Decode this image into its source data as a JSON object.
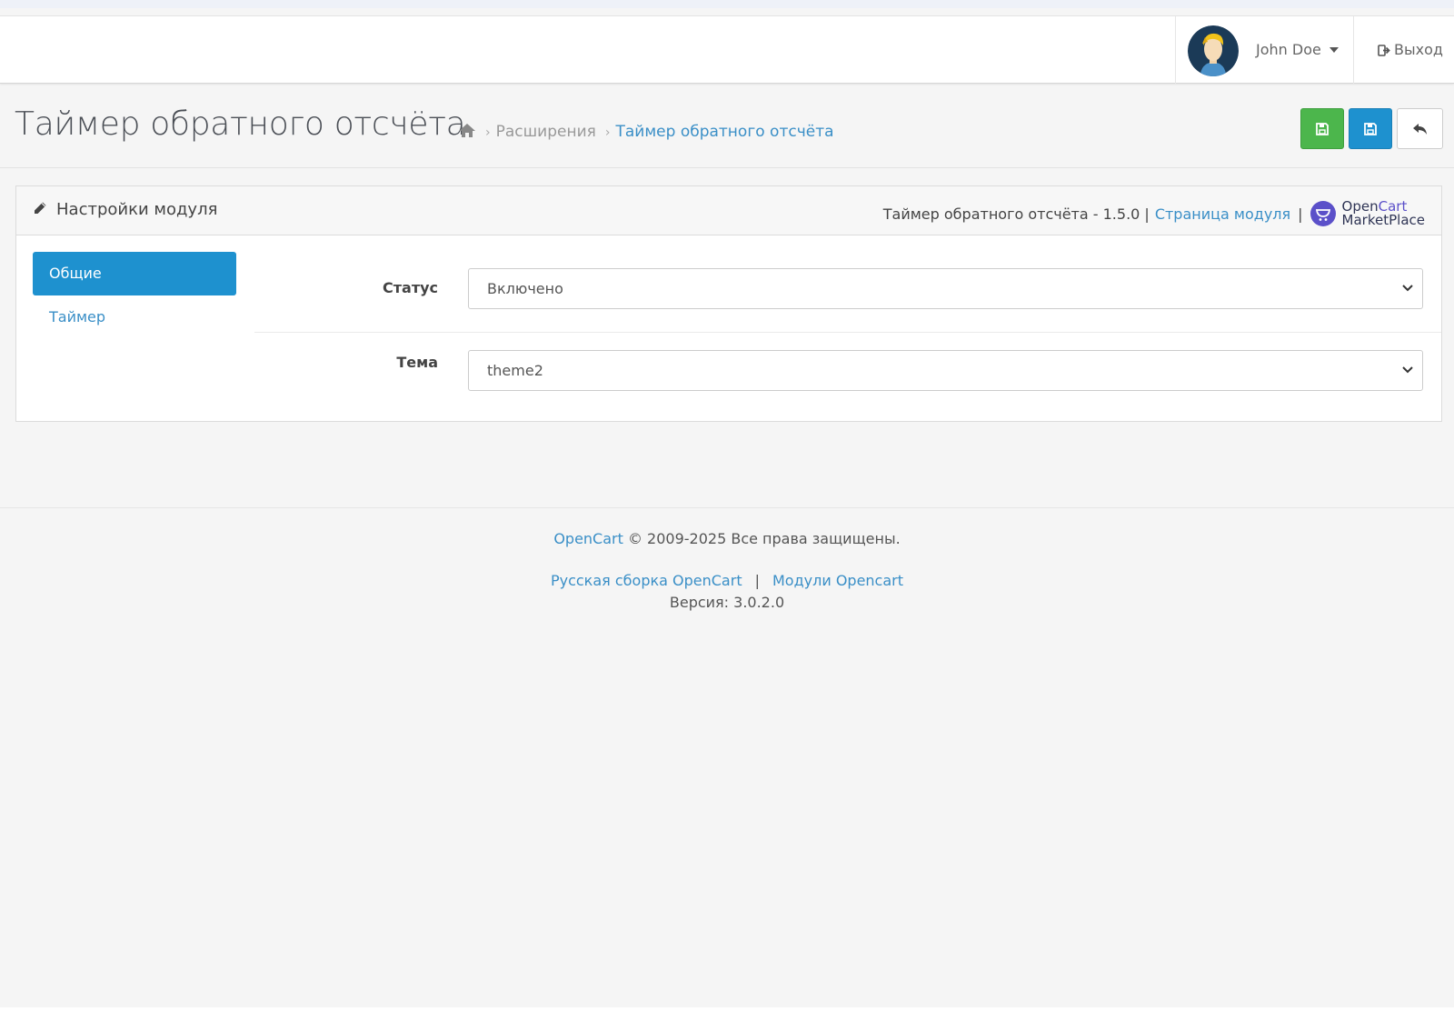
{
  "header": {
    "user_name": "John Doe",
    "logout_label": "Выход"
  },
  "page": {
    "title": "Таймер обратного отсчёта",
    "breadcrumb": [
      "Расширения",
      "Таймер обратного отсчёта"
    ]
  },
  "panel": {
    "title": "Настройки модуля",
    "module_version_text": "Таймер обратного отсчёта - 1.5.0 |",
    "module_page_link": "Страница модуля",
    "separator": "|",
    "logo_text_open": "Open",
    "logo_text_cart": "Cart",
    "logo_text_marketplace": "MarketPlace"
  },
  "tabs": [
    {
      "label": "Общие",
      "active": true
    },
    {
      "label": "Таймер",
      "active": false
    }
  ],
  "form": {
    "status_label": "Статус",
    "status_value": "Включено",
    "theme_label": "Тема",
    "theme_value": "theme2"
  },
  "footer": {
    "opencart_link": "OpenCart",
    "copyright": "© 2009-2025 Все права защищены.",
    "link_russian": "Русская сборка OpenCart",
    "pipe": "|",
    "link_modules": "Модули Opencart",
    "version": "Версия: 3.0.2.0"
  },
  "colors": {
    "primary": "#1e91cf",
    "success": "#4cb64c",
    "link": "#3a8fc7",
    "background": "#f5f5f5"
  }
}
